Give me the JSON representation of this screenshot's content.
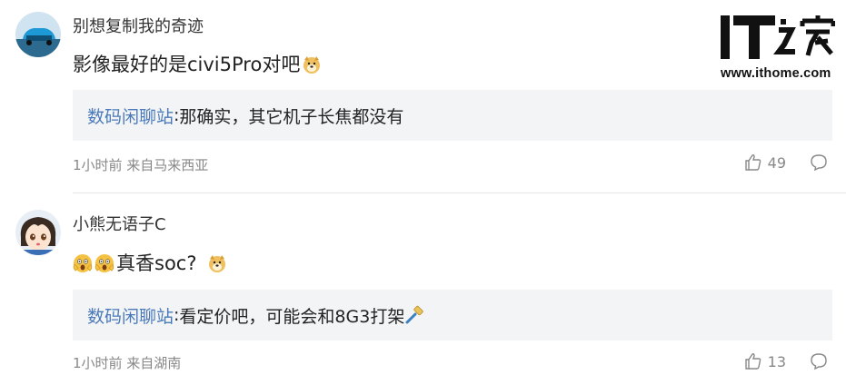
{
  "logo": {
    "mark": "IT之家",
    "url": "www.ithome.com"
  },
  "comments": [
    {
      "username": "别想复制我的奇迹",
      "content_text": "影像最好的是civi5Pro对吧",
      "content_emoji_after": "doge-emoji",
      "quote": {
        "name": "数码闲聊站",
        "colon": ":",
        "text": "那确实，其它机子长焦都没有"
      },
      "meta": "1小时前 来自马来西亚",
      "likes": "49"
    },
    {
      "username": "小熊无语子C",
      "content_emoji_before": [
        "scared-emoji",
        "scared-emoji"
      ],
      "content_text": "真香soc?",
      "content_emoji_after": "doge-emoji",
      "quote": {
        "name": "数码闲聊站",
        "colon": ":",
        "text": "看定价吧，可能会和8G3打架",
        "emoji_after": "hammer-emoji"
      },
      "meta": "1小时前 来自湖南",
      "likes": "13"
    }
  ],
  "colors": {
    "quote_bg": "#f3f4f6",
    "quote_name": "#4a7ab8",
    "meta": "#888888",
    "divider": "#e6e6e6"
  }
}
